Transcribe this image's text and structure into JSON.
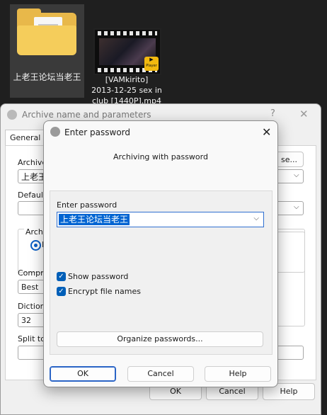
{
  "desktop": {
    "folder_label": "上老王论坛当老王",
    "video_title": "[VAMkirito]",
    "video_name_line2": "2013-12-25 sex in",
    "video_name_line3": "club [1440P].mp4",
    "player_badge": "Player"
  },
  "archive_dialog": {
    "title": "Archive name and parameters",
    "help_glyph": "?",
    "close_glyph": "✕",
    "tab_general": "General",
    "archive_label_partial": "Archive",
    "archive_value_partial": "上老王",
    "browse_partial": "se...",
    "default_label_partial": "Default",
    "archive_format_partial": "Archi",
    "radio_partial": "R",
    "compression_label_partial": "Compre",
    "compression_value": "Best",
    "dictionary_label_partial": "Dictiona",
    "dictionary_value": "32",
    "split_label_partial": "Split to",
    "ok": "OK",
    "cancel": "Cancel",
    "help": "Help"
  },
  "password_dialog": {
    "title": "Enter password",
    "close_glyph": "✕",
    "subtitle": "Archiving with password",
    "enter_password_label": "Enter password",
    "password_value": "上老王论坛当老王",
    "show_password": "Show password",
    "encrypt_file_names": "Encrypt file names",
    "organize_passwords": "Organize passwords...",
    "ok": "OK",
    "cancel": "Cancel",
    "help": "Help"
  },
  "colors": {
    "accent": "#0064d2",
    "checkbox": "#005fb8",
    "desktop_bg": "#1f1f1f"
  }
}
